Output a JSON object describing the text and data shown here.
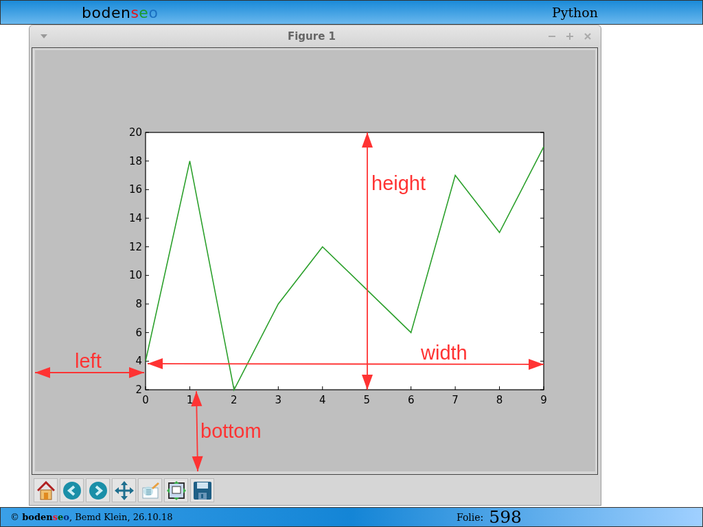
{
  "header": {
    "logo": [
      {
        "text": "boden",
        "color": "#000000"
      },
      {
        "text": "s",
        "color": "#e0141e"
      },
      {
        "text": "e",
        "color": "#1a9a2a"
      },
      {
        "text": "o",
        "color": "#1a6fc0"
      }
    ],
    "title": "Python"
  },
  "window": {
    "title": "Figure 1"
  },
  "figure": {
    "chart_data": {
      "type": "line",
      "x": [
        0,
        1,
        2,
        3,
        4,
        5,
        6,
        7,
        8,
        9
      ],
      "series": [
        {
          "color": "#2ca02c",
          "values": [
            4,
            18,
            2,
            8,
            12,
            9,
            6,
            17,
            13,
            19
          ]
        }
      ],
      "xlim": [
        0,
        9
      ],
      "ylim": [
        2,
        20
      ],
      "xticks": [
        0,
        1,
        2,
        3,
        4,
        5,
        6,
        7,
        8,
        9
      ],
      "yticks": [
        2,
        4,
        6,
        8,
        10,
        12,
        14,
        16,
        18,
        20
      ]
    },
    "annotations": [
      {
        "text": "height"
      },
      {
        "text": "width"
      },
      {
        "text": "left"
      },
      {
        "text": "bottom"
      }
    ]
  },
  "toolbar": [
    {
      "kind": "home"
    },
    {
      "kind": "back"
    },
    {
      "kind": "forward"
    },
    {
      "kind": "pan"
    },
    {
      "kind": "zoom"
    },
    {
      "kind": "subplots"
    },
    {
      "kind": "save"
    }
  ],
  "footer": {
    "copyright": "©",
    "logo": [
      {
        "text": "boden",
        "color": "#000000"
      },
      {
        "text": "s",
        "color": "#ff1020"
      },
      {
        "text": "e",
        "color": "#004a00"
      },
      {
        "text": "o",
        "color": "#002a80"
      }
    ],
    "credit": ", Bemd Klein, 26.10.18",
    "slide_label": "Folie:",
    "slide_number": "598"
  }
}
